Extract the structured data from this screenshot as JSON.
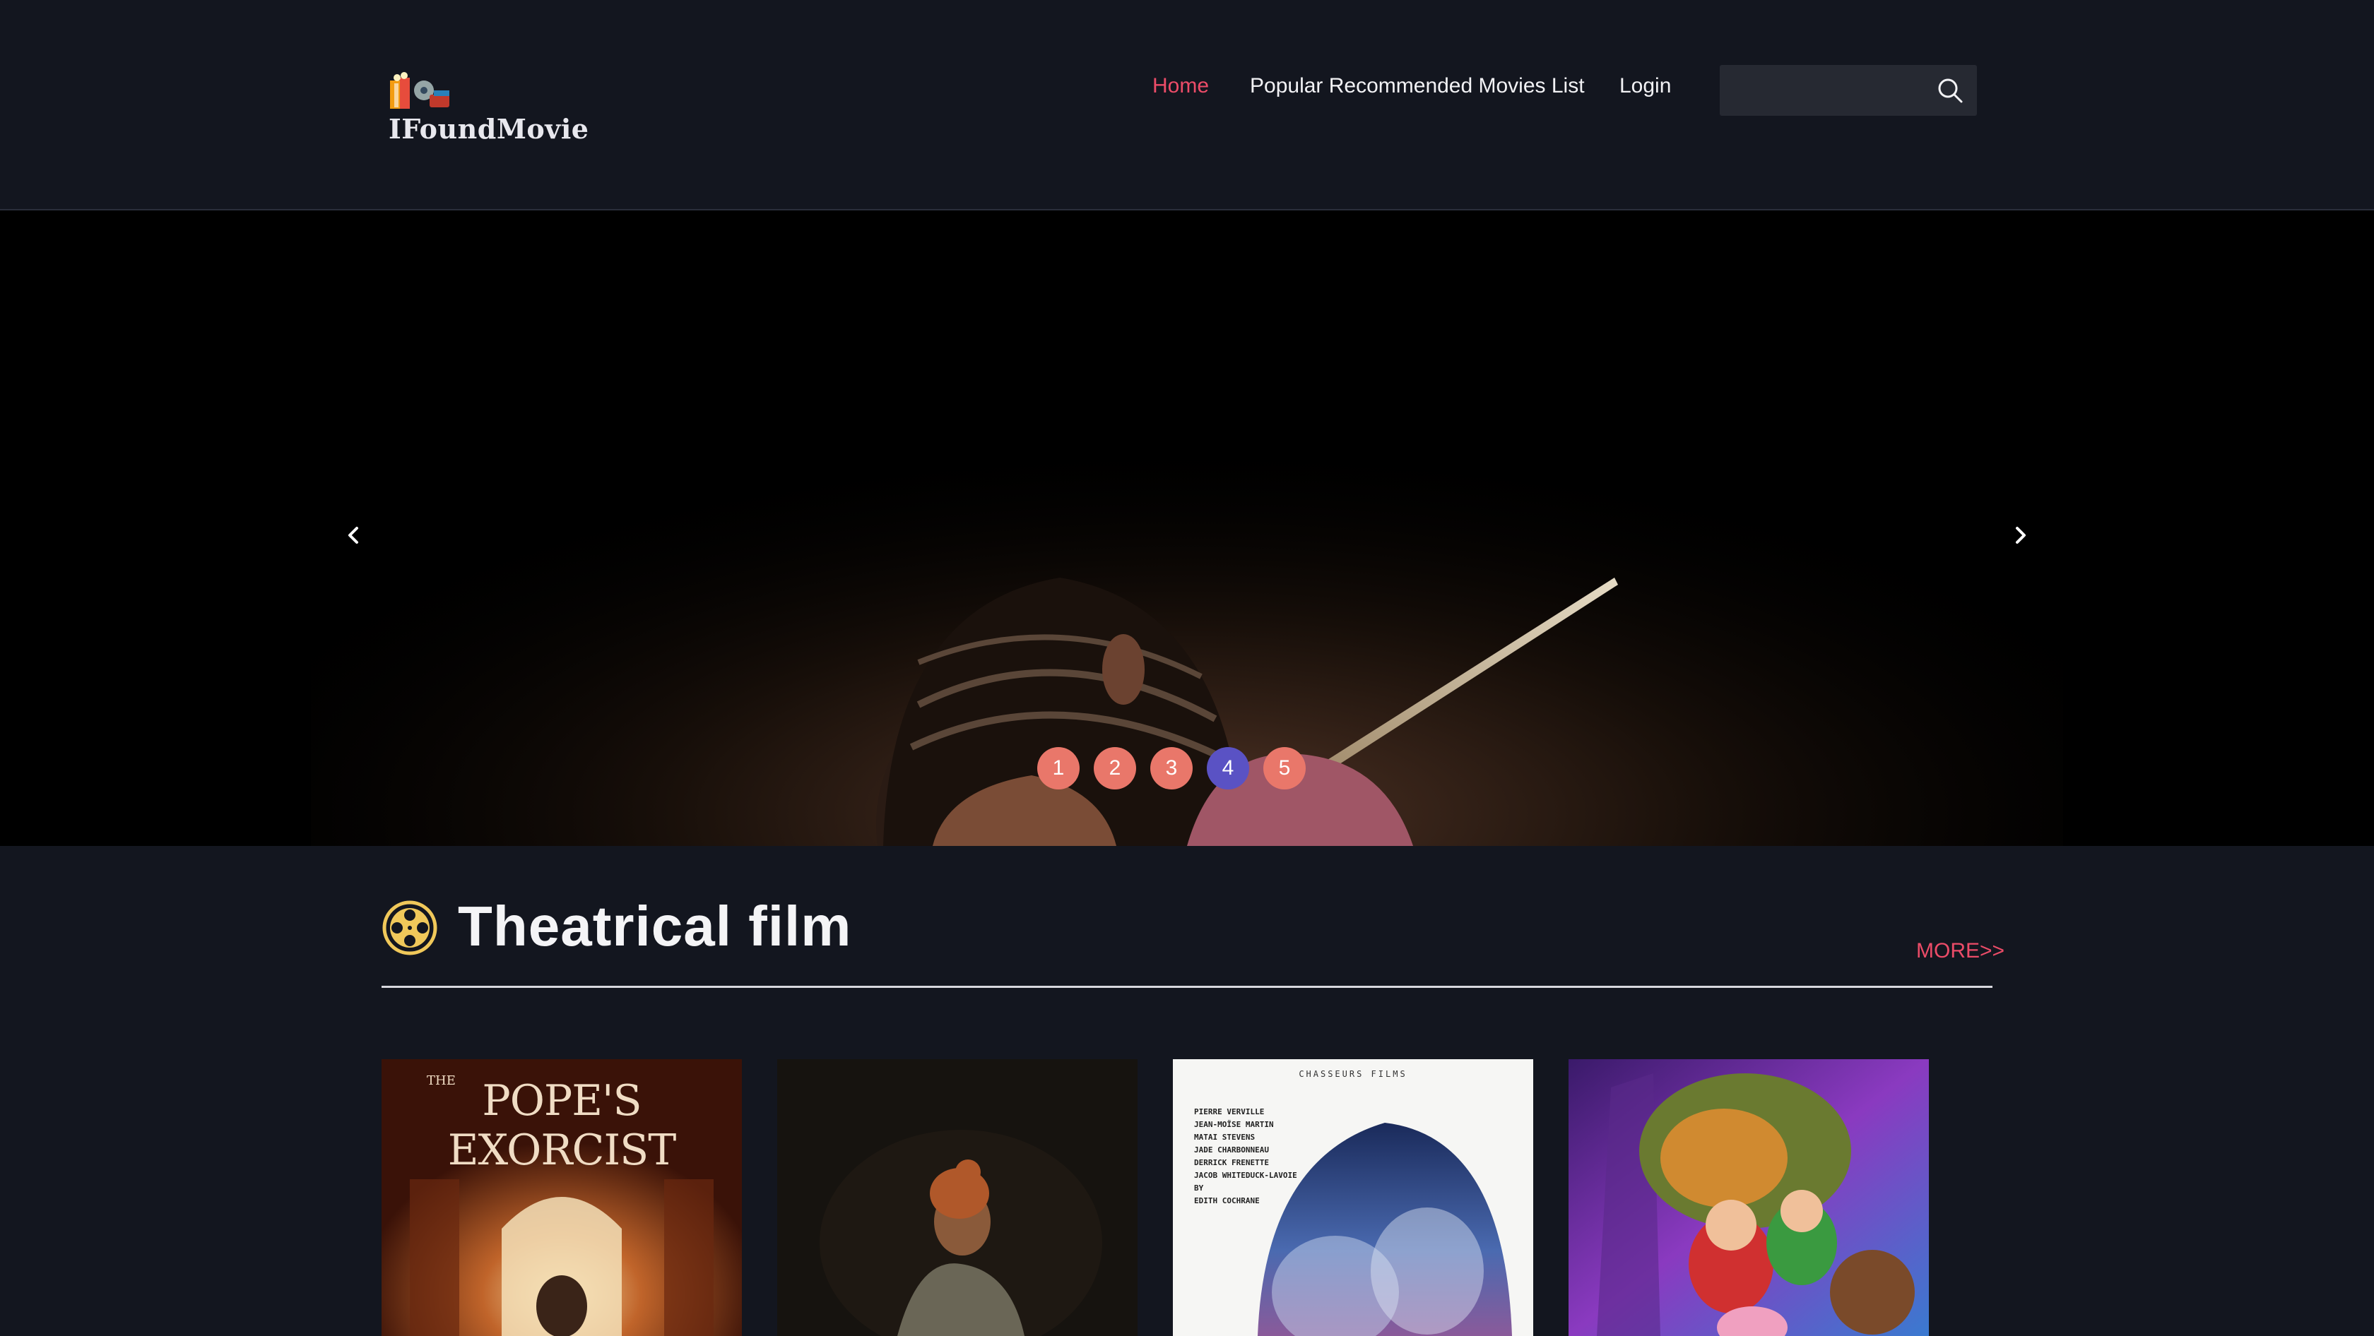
{
  "header": {
    "logo_text": "IFoundMovie",
    "nav": [
      {
        "label": "Home",
        "active": true
      },
      {
        "label": "Popular Recommended Movies List",
        "active": false
      },
      {
        "label": "Login",
        "active": false
      }
    ],
    "search": {
      "placeholder": "",
      "value": ""
    }
  },
  "banner": {
    "slides": [
      "1",
      "2",
      "3",
      "4",
      "5"
    ],
    "active_slide": "4"
  },
  "section": {
    "title": "Theatrical film",
    "more_label": "MORE>>"
  },
  "posters": [
    {
      "title_small": "THE",
      "title": "POPE'S EXORCIST"
    },
    {},
    {
      "studio": "CHASSEURS FILMS",
      "credits": [
        "PIERRE VERVILLE",
        "JEAN-MOÏSE MARTIN",
        "MATAI STEVENS",
        "JADE CHARBONNEAU",
        "DERRICK FRENETTE",
        "JACOB WHITEDUCK-LAVOIE",
        "BY",
        "EDITH COCHRANE"
      ]
    },
    {}
  ],
  "colors": {
    "background": "#13161f",
    "accent": "#ec4c68",
    "slide_dot": "#e9776a",
    "slide_dot_active": "#5a52c4",
    "section_icon": "#f0c85a"
  }
}
